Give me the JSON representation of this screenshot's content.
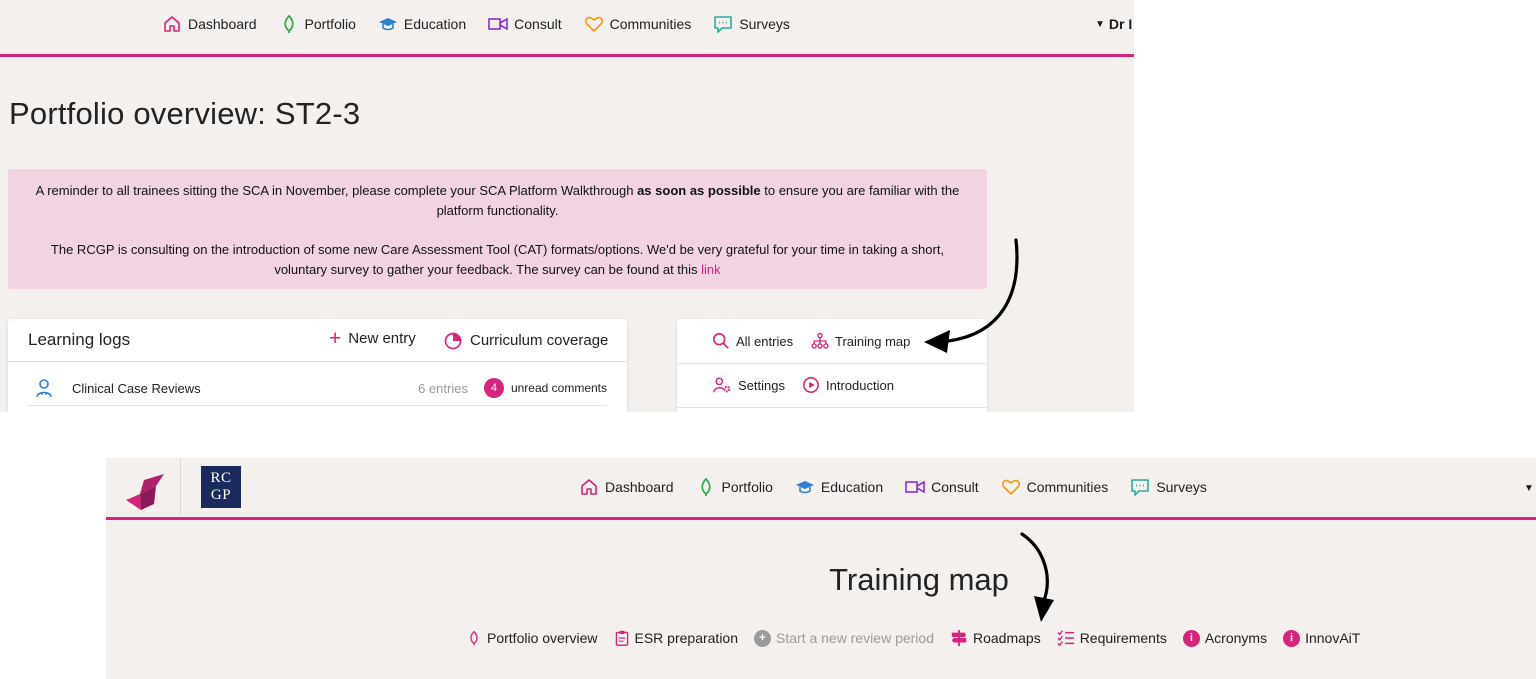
{
  "nav": {
    "items": [
      {
        "label": "Dashboard",
        "icon": "home-icon",
        "color": "#d6247d"
      },
      {
        "label": "Portfolio",
        "icon": "leaf-icon",
        "color": "#2ea84a"
      },
      {
        "label": "Education",
        "icon": "graduation-cap-icon",
        "color": "#2f7fd0"
      },
      {
        "label": "Consult",
        "icon": "video-consult-icon",
        "color": "#8a2fd0"
      },
      {
        "label": "Communities",
        "icon": "heart-icon",
        "color": "#f29a1c"
      },
      {
        "label": "Surveys",
        "icon": "chat-bubble-icon",
        "color": "#2aa9a0"
      }
    ],
    "user_label": "Dr I"
  },
  "portfolio": {
    "title": "Portfolio overview: ST2-3",
    "notice": {
      "p1_start": "A reminder to all trainees sitting the SCA in November, please complete your SCA Platform Walkthrough ",
      "p1_bold": "as soon as possible",
      "p1_end": " to ensure you are familiar with the platform functionality.",
      "p2_text": "The RCGP is consulting on the introduction of some new Care Assessment Tool (CAT) formats/options. We'd be very grateful for your time in taking a short, voluntary survey to gather your feedback. The survey can be found at this ",
      "p2_link": "link"
    },
    "learning_logs": {
      "title": "Learning logs",
      "new_entry": "New entry",
      "curriculum": "Curriculum coverage",
      "rows": [
        {
          "name": "Clinical Case Reviews",
          "count": "6 entries",
          "badge": "4",
          "comments": "unread comments"
        }
      ]
    },
    "entries_card": {
      "all_entries": "All entries",
      "training_map": "Training map",
      "settings": "Settings",
      "introduction": "Introduction"
    }
  },
  "training_map": {
    "logo_text": "RC\nGP",
    "title": "Training map",
    "sub_nav": [
      {
        "label": "Portfolio overview",
        "icon": "leaf-outline-icon"
      },
      {
        "label": "ESR preparation",
        "icon": "clipboard-icon"
      },
      {
        "label": "Start a new review period",
        "icon": "plus-circle-icon",
        "disabled": true
      },
      {
        "label": "Roadmaps",
        "icon": "signpost-icon"
      },
      {
        "label": "Requirements",
        "icon": "checklist-icon"
      },
      {
        "label": "Acronyms",
        "icon": "info-circle-icon"
      },
      {
        "label": "InnovAiT",
        "icon": "info-circle-icon"
      }
    ]
  },
  "colors": {
    "accent": "#d6247d",
    "background": "#f3f0ee",
    "notice": "#f2d3e2",
    "rcgp_navy": "#1b2a5c"
  }
}
